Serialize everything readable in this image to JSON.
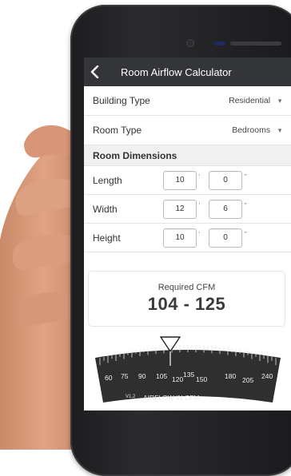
{
  "header": {
    "title": "Room Airflow Calculator"
  },
  "building_type": {
    "label": "Building Type",
    "value": "Residential"
  },
  "room_type": {
    "label": "Room Type",
    "value": "Bedrooms"
  },
  "dimensions": {
    "section_title": "Room Dimensions",
    "foot_symbol": "'",
    "inch_symbol": "\"",
    "rows": [
      {
        "label": "Length",
        "feet": "10",
        "inches": "0"
      },
      {
        "label": "Width",
        "feet": "12",
        "inches": "6"
      },
      {
        "label": "Height",
        "feet": "10",
        "inches": "0"
      }
    ]
  },
  "results": {
    "label": "Required CFM",
    "value": "104 - 125"
  },
  "dial": {
    "ticks": [
      "60",
      "75",
      "90",
      "105",
      "120",
      "135",
      "150",
      "180",
      "205",
      "240"
    ],
    "version": "V1.2",
    "caption": "AIRFLOW IN CFM"
  },
  "colors": {
    "topbar": "#333538",
    "dial": "#2f2f30"
  }
}
